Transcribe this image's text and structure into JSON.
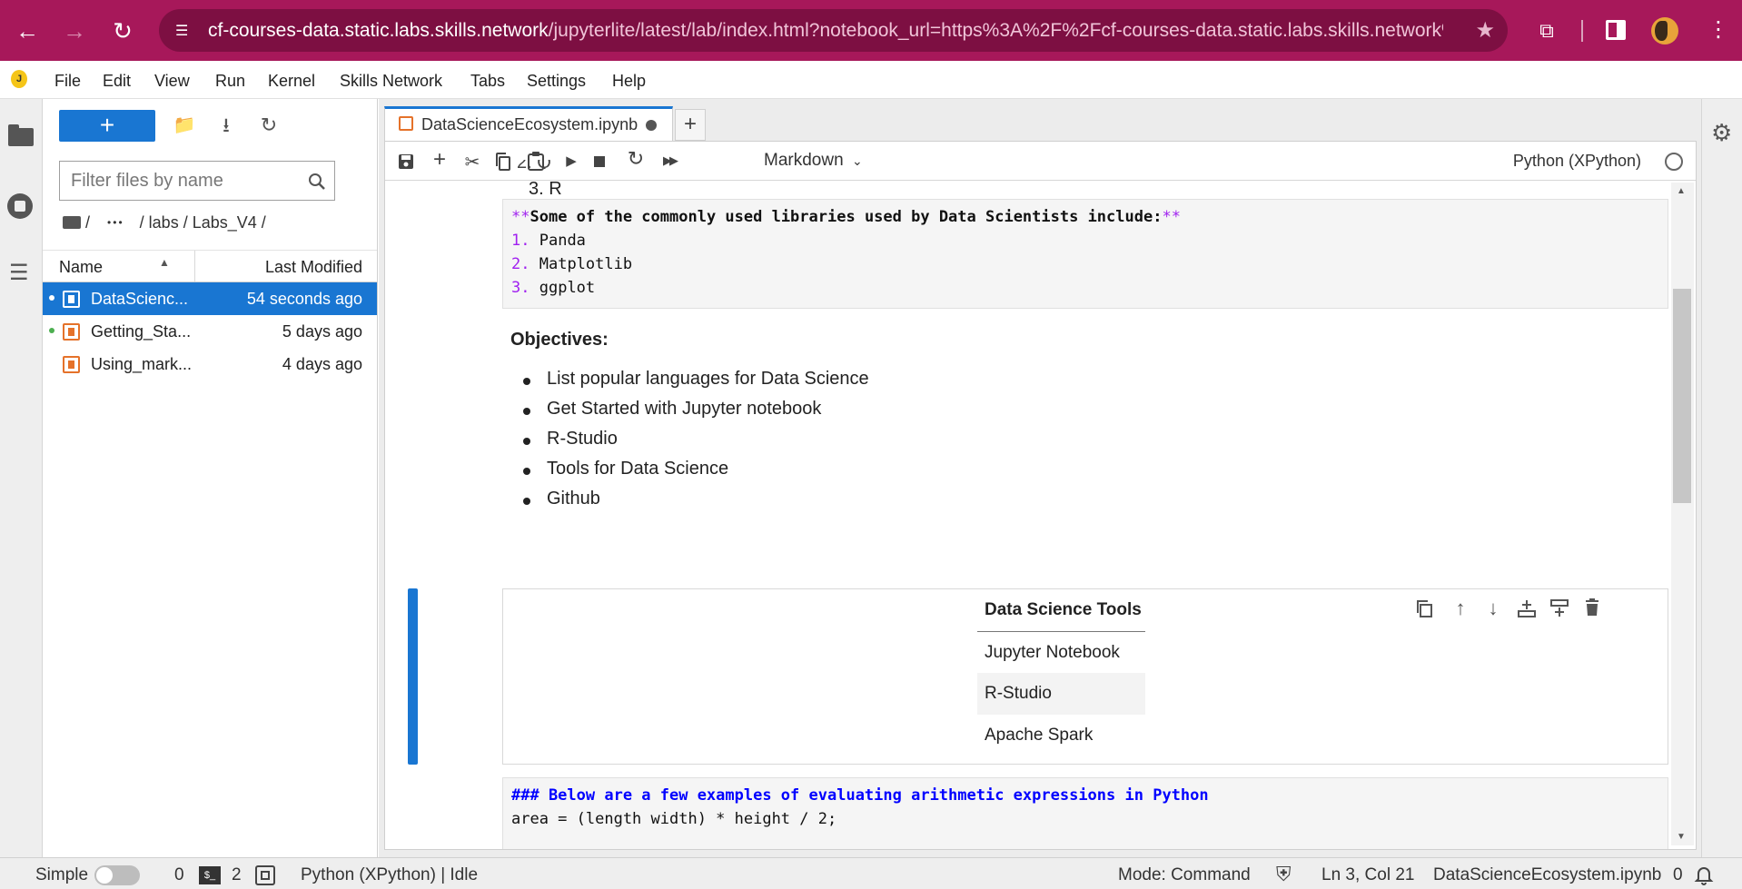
{
  "browser": {
    "url_host": "cf-courses-data.static.labs.skills.network",
    "url_path": "/jupyterlite/latest/lab/index.html?notebook_url=https%3A%2F%2Fcf-courses-data.static.labs.skills.network%2F..."
  },
  "menu": {
    "items": [
      "File",
      "Edit",
      "View",
      "Run",
      "Kernel",
      "Skills Network",
      "Tabs",
      "Settings",
      "Help"
    ]
  },
  "filebrowser": {
    "new_label": "+",
    "filter_placeholder": "Filter files by name",
    "breadcrumb": {
      "root": "/",
      "ellipsis": "•••",
      "path": "/ labs / Labs_V4 /"
    },
    "col_name": "Name",
    "col_modified": "Last Modified",
    "files": [
      {
        "name": "DataScienc...",
        "modified": "54 seconds ago"
      },
      {
        "name": "Getting_Sta...",
        "modified": "5 days ago"
      },
      {
        "name": "Using_mark...",
        "modified": "4 days ago"
      }
    ]
  },
  "tab": {
    "title": "DataScienceEcosystem.ipynb",
    "add_label": "+"
  },
  "toolbar": {
    "cell_type": "Markdown",
    "kernel": "Python (XPython)"
  },
  "cells": {
    "list_tail": "3. R",
    "libs_cell": {
      "md_open": "**",
      "heading": "Some of the commonly used libraries used by Data Scientists include:",
      "md_close": "**",
      "items": [
        {
          "num": "1.",
          "text": "Panda"
        },
        {
          "num": "2.",
          "text": "Matplotlib"
        },
        {
          "num": "3.",
          "text": "ggplot"
        }
      ]
    },
    "objectives": {
      "title": "Objectives:",
      "items": [
        "List popular languages for Data Science",
        "Get Started with Jupyter notebook",
        "R-Studio",
        "Tools for Data Science",
        "Github"
      ]
    },
    "tools_table": {
      "header": "Data Science Tools",
      "rows": [
        "Jupyter Notebook",
        "R-Studio",
        "Apache Spark"
      ]
    },
    "arith_cell": {
      "heading": "### Below are a few examples of evaluating arithmetic expressions in Python",
      "code": "area = (length width) * height / 2;"
    }
  },
  "statusbar": {
    "simple": "Simple",
    "zero": "0",
    "terminals": "2",
    "kernel_status": "Python (XPython) | Idle",
    "mode": "Mode: Command",
    "position": "Ln 3, Col 21",
    "filename": "DataScienceEcosystem.ipynb",
    "notifications": "0"
  }
}
